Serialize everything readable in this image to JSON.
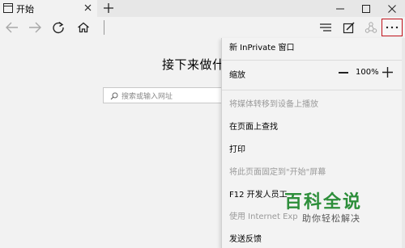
{
  "tab": {
    "title": "开始"
  },
  "content": {
    "heading": "接下来做什",
    "search_placeholder": "搜索或输入网址"
  },
  "menu": {
    "new_inprivate": "新 InPrivate 窗口",
    "zoom_label": "缩放",
    "zoom_value": "100%",
    "cast": "将媒体转移到设备上播放",
    "find": "在页面上查找",
    "print": "打印",
    "pin": "将此页面固定到\"开始\"屏幕",
    "f12": "F12 开发人员工",
    "use_ie": "使用 Internet Exp",
    "feedback": "发送反馈"
  },
  "watermark": {
    "title": "百科全说",
    "subtitle": "助你轻松解决"
  },
  "colors": {
    "highlight_border": "#c0121b",
    "watermark_green": "#2d8e3a"
  }
}
